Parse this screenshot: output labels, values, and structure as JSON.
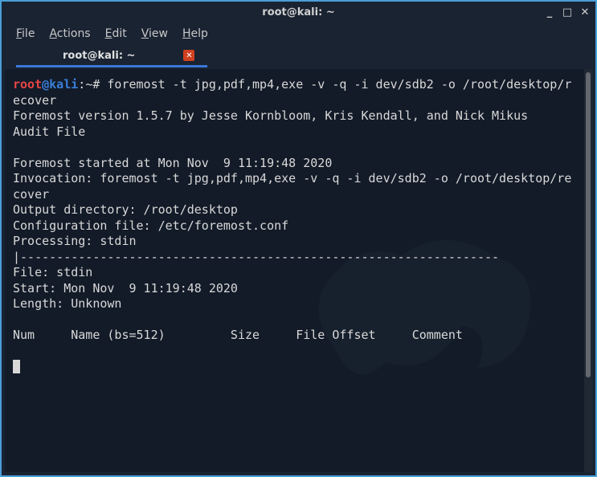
{
  "titlebar": {
    "title": "root@kali: ~"
  },
  "menubar": {
    "file": "File",
    "actions": "Actions",
    "edit": "Edit",
    "view": "View",
    "help": "Help"
  },
  "tab": {
    "label": "root@kali: ~"
  },
  "prompt": {
    "user": "root",
    "at": "@",
    "host": "kali",
    "sep": ":",
    "path": "~",
    "hash": "#"
  },
  "terminal": {
    "command": " foremost -t jpg,pdf,mp4,exe -v -q -i dev/sdb2 -o /root/desktop/recover",
    "line_version": "Foremost version 1.5.7 by Jesse Kornbloom, Kris Kendall, and Nick Mikus",
    "line_audit": "Audit File",
    "blank": "",
    "line_started": "Foremost started at Mon Nov  9 11:19:48 2020",
    "line_invocation": "Invocation: foremost -t jpg,pdf,mp4,exe -v -q -i dev/sdb2 -o /root/desktop/recover",
    "line_outputdir": "Output directory: /root/desktop",
    "line_config": "Configuration file: /etc/foremost.conf",
    "line_processing": "Processing: stdin",
    "line_sep": "|------------------------------------------------------------------",
    "line_file": "File: stdin",
    "line_start": "Start: Mon Nov  9 11:19:48 2020",
    "line_length": "Length: Unknown",
    "line_header": "Num     Name (bs=512)         Size     File Offset     Comment"
  }
}
